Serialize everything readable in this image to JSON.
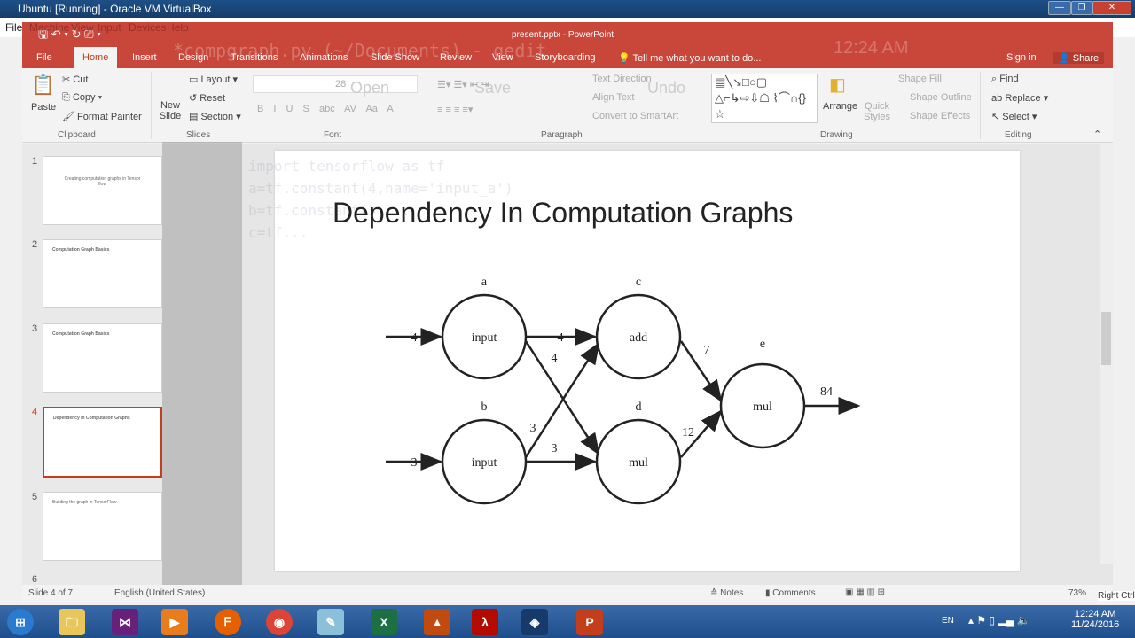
{
  "vbox": {
    "title": "Ubuntu [Running] - Oracle VM VirtualBox",
    "menu": [
      "File",
      "Machine",
      "View",
      "Input",
      "Devices",
      "Help"
    ],
    "controls": [
      "minimize",
      "restore",
      "close"
    ]
  },
  "ppt": {
    "title": "present.pptx - PowerPoint",
    "tabs": [
      "File",
      "Home",
      "Insert",
      "Design",
      "Transitions",
      "Animations",
      "Slide Show",
      "Review",
      "View",
      "Storyboarding"
    ],
    "tell_me": "Tell me what you want to do...",
    "sign_in": "Sign in",
    "share": "Share"
  },
  "ribbon": {
    "clipboard": {
      "paste": "Paste",
      "cut": "Cut",
      "copy": "Copy",
      "format_painter": "Format Painter",
      "label": "Clipboard"
    },
    "slides": {
      "new_slide": "New Slide",
      "layout": "Layout",
      "reset": "Reset",
      "section": "Section",
      "label": "Slides"
    },
    "font": {
      "size": "28",
      "label": "Font",
      "buttons": [
        "B",
        "I",
        "U",
        "S",
        "abc",
        "AV",
        "Aa",
        "A"
      ]
    },
    "paragraph": {
      "text_direction": "Text Direction",
      "align_text": "Align Text",
      "convert": "Convert to SmartArt",
      "label": "Paragraph"
    },
    "drawing": {
      "arrange": "Arrange",
      "quick_styles": "Quick Styles",
      "shape_fill": "Shape Fill",
      "shape_outline": "Shape Outline",
      "shape_effects": "Shape Effects",
      "label": "Drawing"
    },
    "editing": {
      "find": "Find",
      "replace": "Replace",
      "select": "Select",
      "label": "Editing"
    }
  },
  "ghost": {
    "gedit_title": "*compgraph.py (~/Documents) - gedit",
    "tab": "*compgraph.py",
    "open": "Open",
    "save": "Save",
    "undo": "Undo",
    "clock": "12:24 AM",
    "code": [
      "import tensorflow as tf",
      "a=tf.constant(4,name='input_a')",
      "b=tf.constant(3,...",
      "c=tf..."
    ]
  },
  "thumbnails": [
    {
      "num": "1",
      "text": "Creating computation graphs in Tensor flow"
    },
    {
      "num": "2",
      "text": "Computation Graph Basics"
    },
    {
      "num": "3",
      "text": "Computation Graph Basics"
    },
    {
      "num": "4",
      "text": "Dependency In Computation Graphs"
    },
    {
      "num": "5",
      "text": "Building the graph in TensorFlow"
    },
    {
      "num": "6",
      "text": ""
    }
  ],
  "slide": {
    "title": "Dependency In Computation Graphs",
    "nodes": [
      {
        "id": "a",
        "op": "input"
      },
      {
        "id": "b",
        "op": "input"
      },
      {
        "id": "c",
        "op": "add"
      },
      {
        "id": "d",
        "op": "mul"
      },
      {
        "id": "e",
        "op": "mul"
      }
    ],
    "edges": {
      "in_a": "4",
      "in_b": "3",
      "a_c": "4",
      "a_d": "4",
      "b_c": "3",
      "b_d": "3",
      "c_e": "7",
      "d_e": "12",
      "out": "84"
    }
  },
  "status": {
    "slide": "Slide 4 of 7",
    "language": "English (United States)",
    "notes": "Notes",
    "comments": "Comments",
    "zoom": "73%",
    "host_key": "Right Ctrl"
  },
  "taskbar": {
    "lang": "EN",
    "time": "12:24 AM",
    "date": "11/24/2016"
  }
}
